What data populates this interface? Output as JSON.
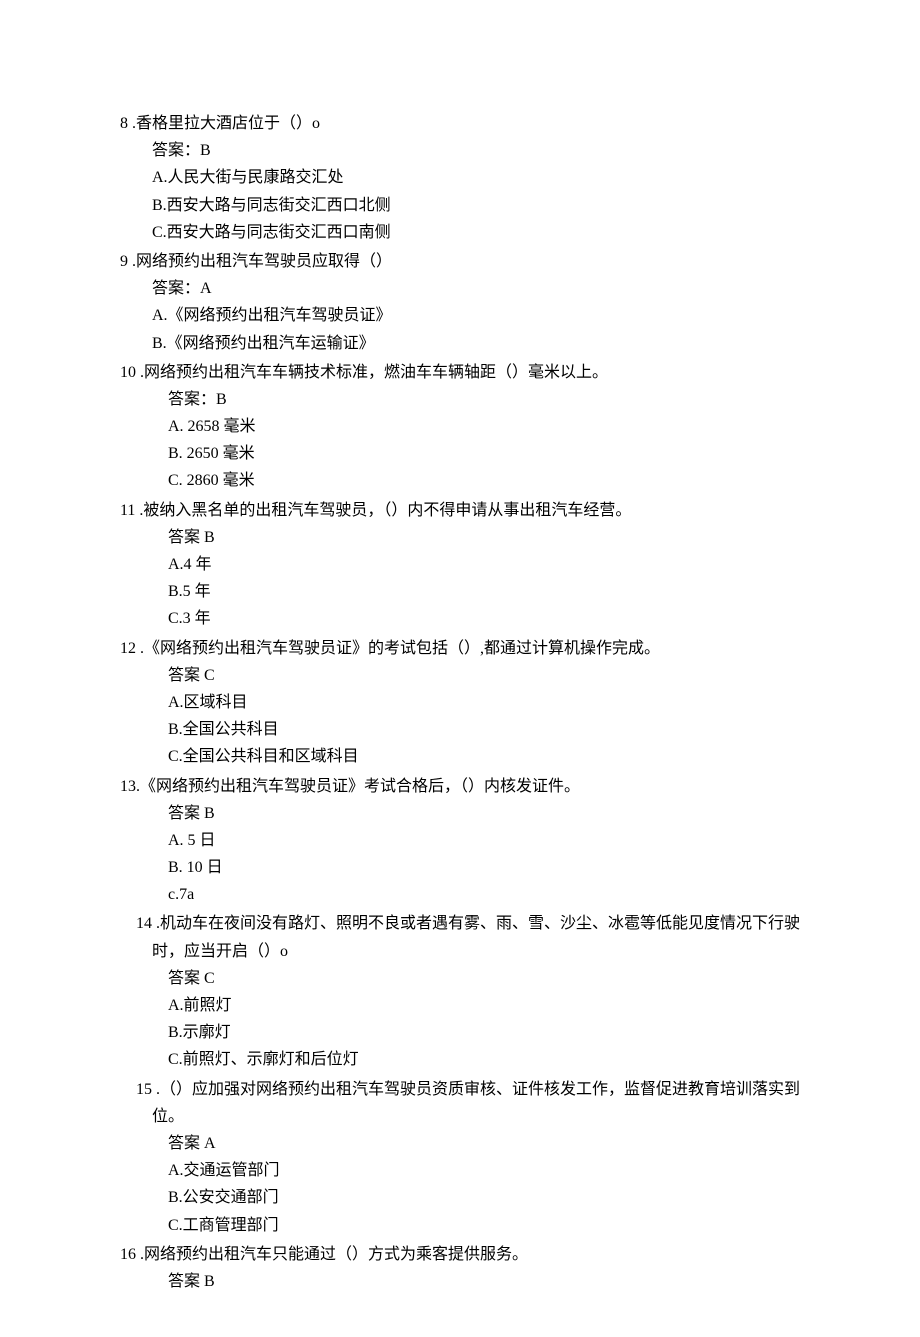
{
  "questions": [
    {
      "num": "8",
      "sep": " .",
      "text": "香格里拉大酒店位于（）o",
      "answer_label": "答案：B",
      "options": [
        "A.人民大街与民康路交汇处",
        "B.西安大路与同志街交汇西口北侧",
        "C.西安大路与同志街交汇西口南侧"
      ],
      "indent": 0
    },
    {
      "num": "9",
      "sep": " .",
      "text": "网络预约出租汽车驾驶员应取得（）",
      "answer_label": "答案：A",
      "options": [
        "A.《网络预约出租汽车驾驶员证》",
        "B.《网络预约出租汽车运输证》"
      ],
      "indent": 0
    },
    {
      "num": "10",
      "sep": " .",
      "text": "网络预约出租汽车车辆技术标准，燃油车车辆轴距（）毫米以上。",
      "answer_label": "答案：B",
      "options": [
        "A.   2658 毫米",
        "B.   2650 毫米",
        "C.   2860 毫米"
      ],
      "indent": 1
    },
    {
      "num": "11",
      "sep": " .",
      "text": "被纳入黑名单的出租汽车驾驶员，（）内不得申请从事出租汽车经营。",
      "answer_label": "答案 B",
      "options": [
        "A.4 年",
        "B.5 年",
        "C.3 年"
      ],
      "indent": 1
    },
    {
      "num": "12",
      "sep": " .",
      "text": "《网络预约出租汽车驾驶员证》的考试包括（）,都通过计算机操作完成。",
      "answer_label": "答案 C",
      "options": [
        "A.区域科目",
        "B.全国公共科目",
        "C.全国公共科目和区域科目"
      ],
      "indent": 1
    },
    {
      "num": "13.",
      "sep": "",
      "text": "《网络预约出租汽车驾驶员证》考试合格后，（）内核发证件。",
      "answer_label": "答案 B",
      "options": [
        "A.   5 日",
        "B.   10 日",
        "c.7a"
      ],
      "indent": 1
    },
    {
      "num": "14",
      "sep": " .",
      "text": "机动车在夜间没有路灯、照明不良或者遇有雾、雨、雪、沙尘、冰雹等低能见度情况下行驶时，应当开启（）o",
      "answer_label": "答案 C",
      "options": [
        "A.前照灯",
        "B.示廓灯",
        "C.前照灯、示廓灯和后位灯"
      ],
      "indent": 1,
      "lead_pad": 1
    },
    {
      "num": "15",
      "sep": " .",
      "text": "（）应加强对网络预约出租汽车驾驶员资质审核、证件核发工作，监督促进教育培训落实到位。",
      "answer_label": "答案 A",
      "options": [
        "A.交通运管部门",
        "B.公安交通部门",
        "C.工商管理部门"
      ],
      "indent": 1,
      "lead_pad": 1
    },
    {
      "num": "16",
      "sep": " .",
      "text": "网络预约出租汽车只能通过（）方式为乘客提供服务。",
      "answer_label": "答案 B",
      "options": [],
      "indent": 1
    }
  ]
}
